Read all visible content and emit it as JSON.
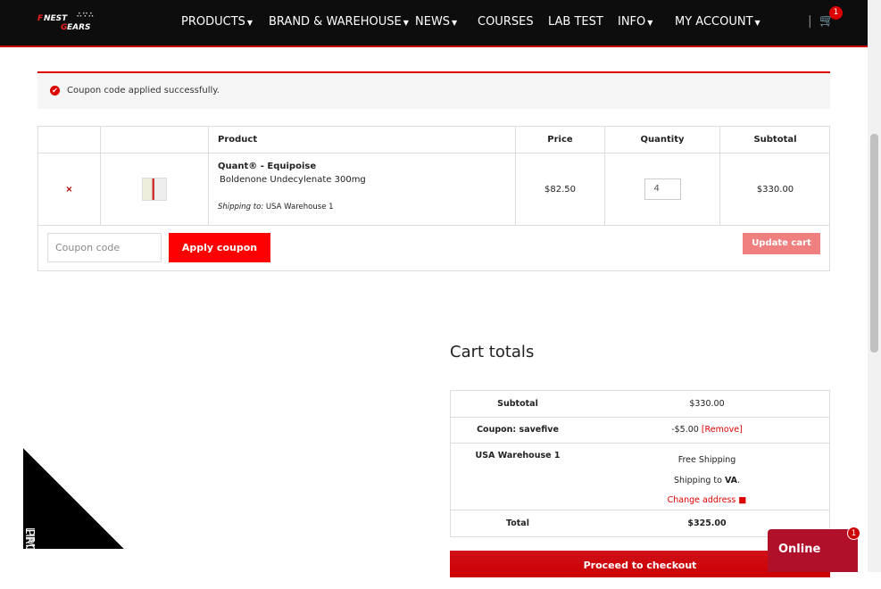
{
  "nav": {
    "logo": "FINEST GEARS",
    "menu": [
      {
        "label": "PRODUCTS",
        "dropdown": true
      },
      {
        "label": "BRAND & WAREHOUSE",
        "dropdown": true
      },
      {
        "label": "NEWS",
        "dropdown": true
      },
      {
        "label": "COURSES",
        "dropdown": false
      },
      {
        "label": "LAB TEST",
        "dropdown": false
      },
      {
        "label": "INFO",
        "dropdown": true
      },
      {
        "label": "MY ACCOUNT",
        "dropdown": true
      }
    ],
    "cart_count": "1"
  },
  "notice": "Coupon code applied successfully.",
  "table": {
    "headers": [
      "",
      "",
      "Product",
      "Price",
      "Quantity",
      "Subtotal"
    ],
    "item": {
      "remove": "×",
      "name": "Quant® - Equipoise",
      "desc": "Boldenone Undecylenate 300mg",
      "shipping_label": "Shipping to:",
      "shipping_value": "USA Warehouse 1",
      "price": "$82.50",
      "quantity": "4",
      "subtotal": "$330.00"
    },
    "coupon_placeholder": "Coupon code",
    "apply_label": "Apply coupon",
    "update_label": "Update cart"
  },
  "totals": {
    "title": "Cart totals",
    "subtotal_label": "Subtotal",
    "subtotal": "$330.00",
    "coupon_label": "Coupon: savefive",
    "coupon_value": "-$5.00",
    "remove_label": "[Remove]",
    "shipping_label": "USA Warehouse 1",
    "shipping_method": "Free Shipping",
    "shipping_to": "Shipping to",
    "shipping_state": "VA",
    "change_address": "Change address",
    "total_label": "Total",
    "total": "$325.00",
    "checkout": "Proceed to checkout"
  },
  "chat": {
    "label": "Online",
    "count": "1"
  },
  "promo": {
    "line1": "LIMITED",
    "line2": "PROMO"
  }
}
